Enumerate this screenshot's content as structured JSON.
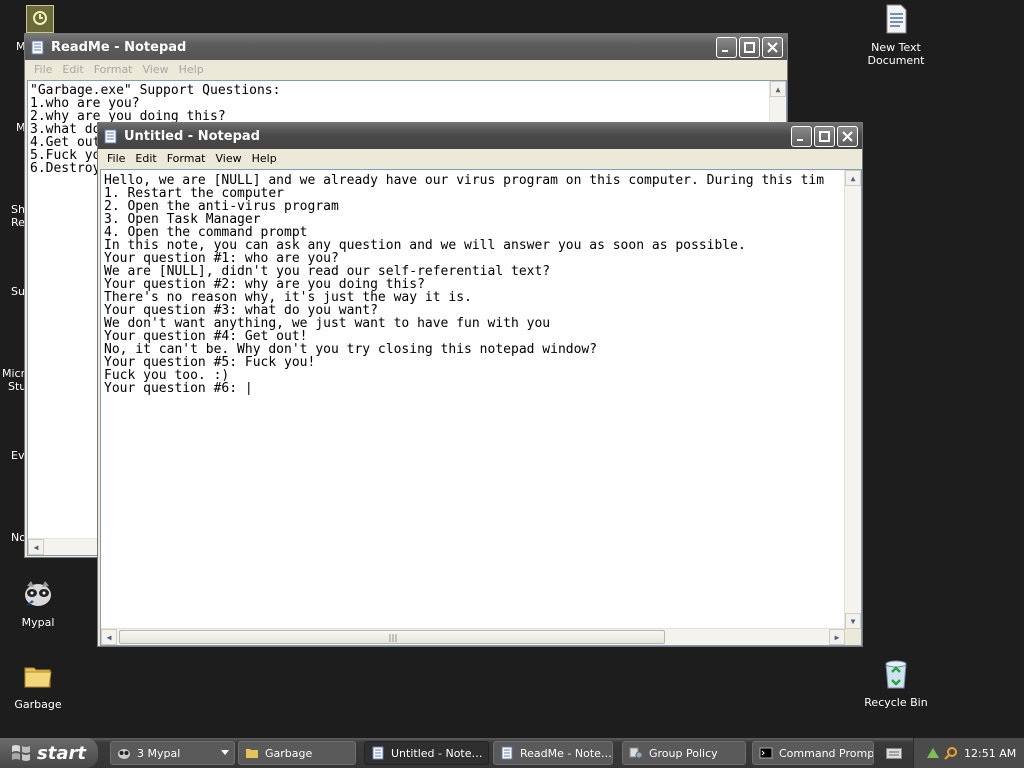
{
  "desktop": {
    "icons": [
      {
        "key": "mypal",
        "label": "Mypal"
      },
      {
        "key": "garbage",
        "label": "Garbage"
      },
      {
        "key": "new_text",
        "label": "New Text Document"
      },
      {
        "key": "recycle",
        "label": "Recycle Bin"
      }
    ],
    "partial_labels": [
      "M",
      "M",
      "Sh",
      "Re",
      "Su",
      "Micr",
      "Stu",
      "Ev",
      "No"
    ]
  },
  "readme_window": {
    "title": "ReadMe - Notepad",
    "menu": [
      "File",
      "Edit",
      "Format",
      "View",
      "Help"
    ],
    "lines": [
      "\"Garbage.exe\" Support Questions:",
      "1.who are you?",
      "2.why are you doing this?",
      "3.what do",
      "4.Get out",
      "5.Fuck yo",
      "6.Destroy"
    ]
  },
  "untitled_window": {
    "title": "Untitled - Notepad",
    "menu": [
      "File",
      "Edit",
      "Format",
      "View",
      "Help"
    ],
    "lines": [
      "Hello, we are [NULL] and we already have our virus program on this computer. During this tim",
      "1. Restart the computer",
      "2. Open the anti-virus program",
      "3. Open Task Manager",
      "4. Open the command prompt",
      "In this note, you can ask any question and we will answer you as soon as possible.",
      "Your question #1: who are you?",
      "We are [NULL], didn't you read our self-referential text?",
      "Your question #2: why are you doing this?",
      "There's no reason why, it's just the way it is.",
      "Your question #3: what do you want?",
      "We don't want anything, we just want to have fun with you",
      "Your question #4: Get out!",
      "No, it can't be. Why don't you try closing this notepad window?",
      "Your question #5: Fuck you!",
      "Fuck you too. :)",
      "Your question #6: |"
    ]
  },
  "taskbar": {
    "start_label": "start",
    "tasks": [
      {
        "label": "3 Mypal",
        "icon": "mypal-icon"
      },
      {
        "label": "Garbage",
        "icon": "folder-icon"
      },
      {
        "label": "Untitled - Note…",
        "icon": "notepad-icon",
        "active": true
      },
      {
        "label": "ReadMe - Note…",
        "icon": "notepad-icon"
      },
      {
        "label": "Group Policy",
        "icon": "group-policy-icon"
      },
      {
        "label": "Command Prompt",
        "icon": "cmd-icon"
      }
    ],
    "clock": "12:51 AM"
  }
}
